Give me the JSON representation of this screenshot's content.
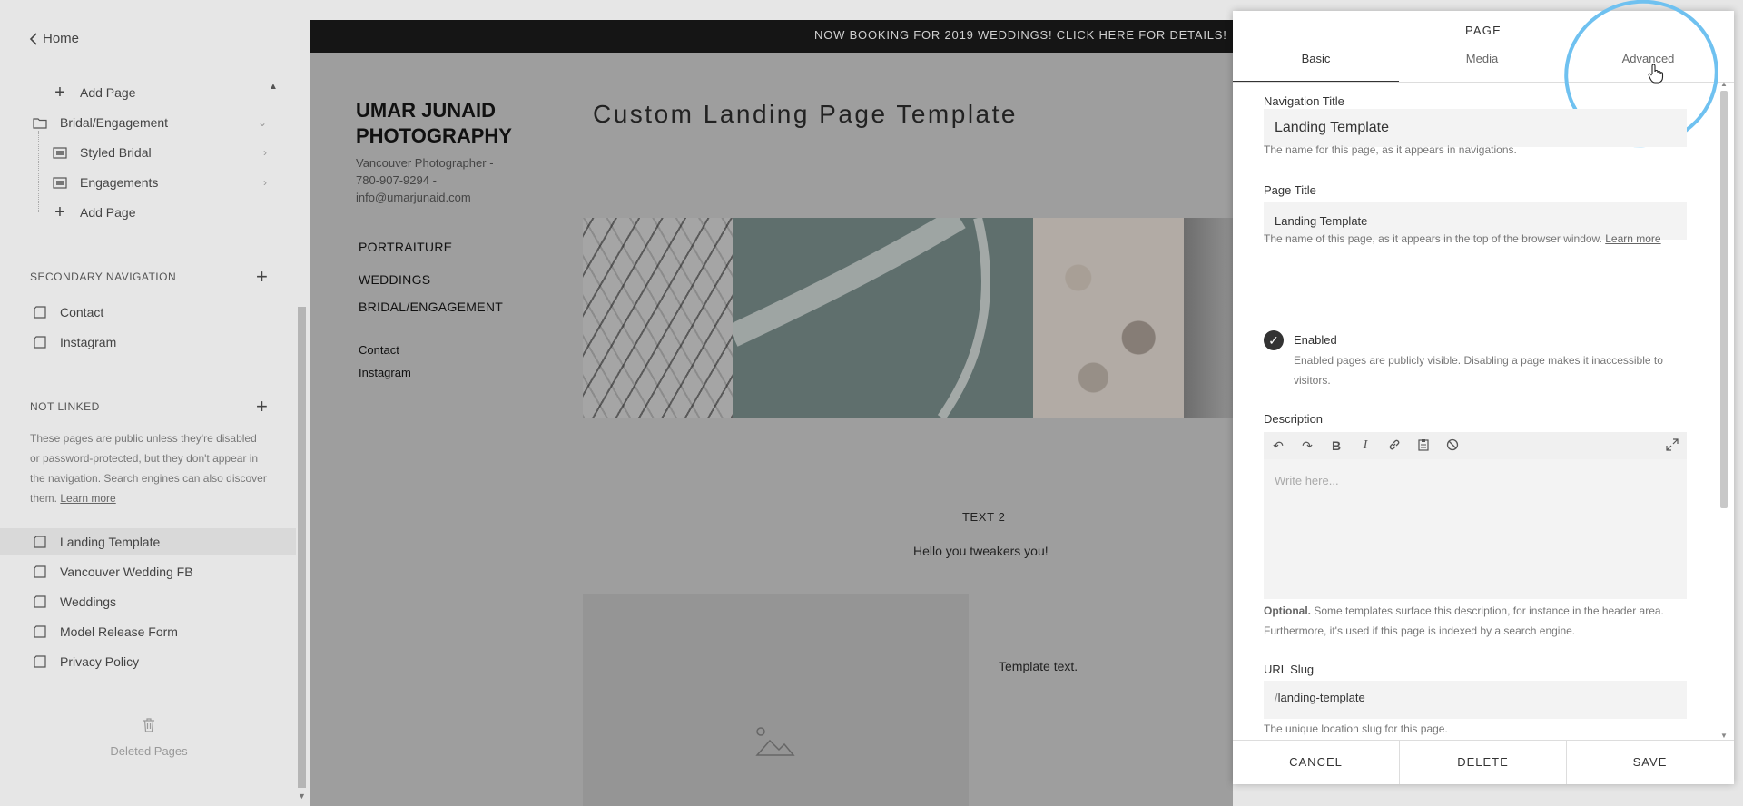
{
  "sidebar": {
    "home_label": "Home",
    "main_items": [
      {
        "label": "Add Page",
        "icon": "plus-icon"
      },
      {
        "label": "Bridal/Engagement",
        "icon": "folder-icon"
      },
      {
        "label": "Styled Bridal",
        "icon": "gallery-icon"
      },
      {
        "label": "Engagements",
        "icon": "gallery-icon"
      },
      {
        "label": "Add Page",
        "icon": "plus-icon"
      }
    ],
    "secondary_heading": "SECONDARY NAVIGATION",
    "secondary_items": [
      {
        "label": "Contact",
        "icon": "page-icon"
      },
      {
        "label": "Instagram",
        "icon": "page-icon"
      }
    ],
    "not_linked_heading": "NOT LINKED",
    "not_linked_note": "These pages are public unless they're disabled or password-protected, but they don't appear in the navigation. Search engines can also discover them.",
    "learn_more": "Learn more",
    "not_linked_items": [
      {
        "label": "Landing Template",
        "icon": "page-icon"
      },
      {
        "label": "Vancouver Wedding FB",
        "icon": "page-icon"
      },
      {
        "label": "Weddings",
        "icon": "page-icon"
      },
      {
        "label": "Model Release Form",
        "icon": "page-icon"
      },
      {
        "label": "Privacy Policy",
        "icon": "page-icon"
      }
    ],
    "deleted_pages": "Deleted Pages"
  },
  "preview": {
    "announcement": "NOW BOOKING FOR 2019 WEDDINGS! CLICK HERE FOR DETAILS!",
    "brand_line1": "UMAR JUNAID",
    "brand_line2": "PHOTOGRAPHY",
    "brand_sub1": "Vancouver Photographer -",
    "brand_sub2": "780-907-9294 -",
    "brand_sub3": "info@umarjunaid.com",
    "nav": [
      "PORTRAITURE",
      "WEDDINGS",
      "BRIDAL/ENGAGEMENT"
    ],
    "subnav": [
      "Contact",
      "Instagram"
    ],
    "page_title": "Custom Landing Page Template",
    "text2": "TEXT 2",
    "hello": "Hello you tweakers you!",
    "template_text": "Template text."
  },
  "panel": {
    "title": "PAGE",
    "tabs": [
      "Basic",
      "Media",
      "Advanced"
    ],
    "nav_title_label": "Navigation Title",
    "nav_title_value": "Landing Template",
    "nav_title_help": "The name for this page, as it appears in navigations.",
    "page_title_label": "Page Title",
    "page_title_value": "Landing Template",
    "page_title_help": "The name of this page, as it appears in the top of the browser window.",
    "learn_more": "Learn more",
    "enabled_label": "Enabled",
    "enabled_help": "Enabled pages are publicly visible. Disabling a page makes it inaccessible to visitors.",
    "description_label": "Description",
    "description_placeholder": "Write here...",
    "optional_bold": "Optional.",
    "optional_help": " Some templates surface this description, for instance in the header area. Furthermore, it's used if this page is indexed by a search engine.",
    "url_slug_label": "URL Slug",
    "url_slug_prefix": "/",
    "url_slug_value": "landing-template",
    "url_slug_help": "The unique location slug for this page.",
    "cancel": "CANCEL",
    "delete": "DELETE",
    "save": "SAVE"
  },
  "colors": {
    "highlight_circle": "#6fc1f0",
    "announcement_bar": "#151515"
  }
}
